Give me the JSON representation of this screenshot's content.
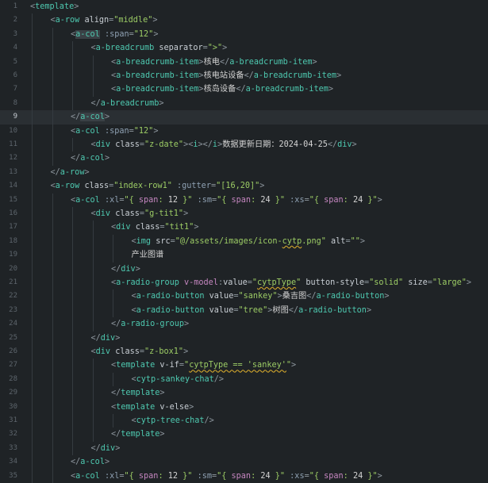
{
  "editor": {
    "current_line": 9,
    "lines": [
      {
        "n": "1",
        "i": 0,
        "t": [
          [
            "p",
            "<"
          ],
          [
            "tag",
            "template"
          ],
          [
            "p",
            ">"
          ]
        ]
      },
      {
        "n": "2",
        "i": 1,
        "t": [
          [
            "p",
            "<"
          ],
          [
            "tag",
            "a-row"
          ],
          [
            "p",
            " "
          ],
          [
            "attr",
            "align"
          ],
          [
            "p",
            "="
          ],
          [
            "str",
            "\"middle\""
          ],
          [
            "p",
            ">"
          ]
        ]
      },
      {
        "n": "3",
        "i": 2,
        "t": [
          [
            "p",
            "<"
          ],
          [
            "taghl",
            "a-col"
          ],
          [
            "p",
            " "
          ],
          [
            "bind",
            ":span"
          ],
          [
            "p",
            "="
          ],
          [
            "str",
            "\"12\""
          ],
          [
            "p",
            ">"
          ]
        ]
      },
      {
        "n": "4",
        "i": 3,
        "t": [
          [
            "p",
            "<"
          ],
          [
            "tag",
            "a-breadcrumb"
          ],
          [
            "p",
            " "
          ],
          [
            "attr",
            "separator"
          ],
          [
            "p",
            "="
          ],
          [
            "str",
            "\">\""
          ],
          [
            "p",
            ">"
          ]
        ]
      },
      {
        "n": "5",
        "i": 4,
        "t": [
          [
            "p",
            "<"
          ],
          [
            "tag",
            "a-breadcrumb-item"
          ],
          [
            "p",
            ">"
          ],
          [
            "text",
            "核电"
          ],
          [
            "p",
            "</"
          ],
          [
            "tag",
            "a-breadcrumb-item"
          ],
          [
            "p",
            ">"
          ]
        ]
      },
      {
        "n": "6",
        "i": 4,
        "t": [
          [
            "p",
            "<"
          ],
          [
            "tag",
            "a-breadcrumb-item"
          ],
          [
            "p",
            ">"
          ],
          [
            "text",
            "核电站设备"
          ],
          [
            "p",
            "</"
          ],
          [
            "tag",
            "a-breadcrumb-item"
          ],
          [
            "p",
            ">"
          ]
        ]
      },
      {
        "n": "7",
        "i": 4,
        "t": [
          [
            "p",
            "<"
          ],
          [
            "tag",
            "a-breadcrumb-item"
          ],
          [
            "p",
            ">"
          ],
          [
            "text",
            "核岛设备"
          ],
          [
            "p",
            "</"
          ],
          [
            "tag",
            "a-breadcrumb-item"
          ],
          [
            "p",
            ">"
          ]
        ]
      },
      {
        "n": "8",
        "i": 3,
        "t": [
          [
            "p",
            "</"
          ],
          [
            "tag",
            "a-breadcrumb"
          ],
          [
            "p",
            ">"
          ]
        ]
      },
      {
        "n": "9",
        "i": 2,
        "t": [
          [
            "p",
            "</"
          ],
          [
            "taghl",
            "a-col"
          ],
          [
            "p",
            ">"
          ]
        ]
      },
      {
        "n": "10",
        "i": 2,
        "t": [
          [
            "p",
            "<"
          ],
          [
            "tag",
            "a-col"
          ],
          [
            "p",
            " "
          ],
          [
            "bind",
            ":span"
          ],
          [
            "p",
            "="
          ],
          [
            "str",
            "\"12\""
          ],
          [
            "p",
            ">"
          ]
        ]
      },
      {
        "n": "11",
        "i": 3,
        "t": [
          [
            "p",
            "<"
          ],
          [
            "tag",
            "div"
          ],
          [
            "p",
            " "
          ],
          [
            "attr",
            "class"
          ],
          [
            "p",
            "="
          ],
          [
            "str",
            "\"z-date\""
          ],
          [
            "p",
            ">"
          ],
          [
            "p",
            "<"
          ],
          [
            "tag",
            "i"
          ],
          [
            "p",
            ">"
          ],
          [
            "p",
            "</"
          ],
          [
            "tag",
            "i"
          ],
          [
            "p",
            ">"
          ],
          [
            "text",
            "数据更新日期：2024-04-25"
          ],
          [
            "p",
            "</"
          ],
          [
            "tag",
            "div"
          ],
          [
            "p",
            ">"
          ]
        ]
      },
      {
        "n": "12",
        "i": 2,
        "t": [
          [
            "p",
            "</"
          ],
          [
            "tag",
            "a-col"
          ],
          [
            "p",
            ">"
          ]
        ]
      },
      {
        "n": "13",
        "i": 1,
        "t": [
          [
            "p",
            "</"
          ],
          [
            "tag",
            "a-row"
          ],
          [
            "p",
            ">"
          ]
        ]
      },
      {
        "n": "14",
        "i": 1,
        "t": [
          [
            "p",
            "<"
          ],
          [
            "tag",
            "a-row"
          ],
          [
            "p",
            " "
          ],
          [
            "attr",
            "class"
          ],
          [
            "p",
            "="
          ],
          [
            "str",
            "\"index-row1\""
          ],
          [
            "p",
            " "
          ],
          [
            "bind",
            ":gutter"
          ],
          [
            "p",
            "="
          ],
          [
            "str",
            "\"[16,20]\""
          ],
          [
            "p",
            ">"
          ]
        ]
      },
      {
        "n": "15",
        "i": 2,
        "t": [
          [
            "p",
            "<"
          ],
          [
            "tag",
            "a-col"
          ],
          [
            "p",
            " "
          ],
          [
            "bind",
            ":xl"
          ],
          [
            "p",
            "="
          ],
          [
            "str",
            "\"{ "
          ],
          [
            "kw",
            "span"
          ],
          [
            "str",
            ": "
          ],
          [
            "num",
            "12"
          ],
          [
            "str",
            " }\""
          ],
          [
            "p",
            " "
          ],
          [
            "bind",
            ":sm"
          ],
          [
            "p",
            "="
          ],
          [
            "str",
            "\"{ "
          ],
          [
            "kw",
            "span"
          ],
          [
            "str",
            ": "
          ],
          [
            "num",
            "24"
          ],
          [
            "str",
            " }\""
          ],
          [
            "p",
            " "
          ],
          [
            "bind",
            ":xs"
          ],
          [
            "p",
            "="
          ],
          [
            "str",
            "\"{ "
          ],
          [
            "kw",
            "span"
          ],
          [
            "str",
            ": "
          ],
          [
            "num",
            "24"
          ],
          [
            "str",
            " }\""
          ],
          [
            "p",
            ">"
          ]
        ]
      },
      {
        "n": "16",
        "i": 3,
        "t": [
          [
            "p",
            "<"
          ],
          [
            "tag",
            "div"
          ],
          [
            "p",
            " "
          ],
          [
            "attr",
            "class"
          ],
          [
            "p",
            "="
          ],
          [
            "str",
            "\"g-tit1\""
          ],
          [
            "p",
            ">"
          ]
        ]
      },
      {
        "n": "17",
        "i": 4,
        "t": [
          [
            "p",
            "<"
          ],
          [
            "tag",
            "div"
          ],
          [
            "p",
            " "
          ],
          [
            "attr",
            "class"
          ],
          [
            "p",
            "="
          ],
          [
            "str",
            "\"tit1\""
          ],
          [
            "p",
            ">"
          ]
        ]
      },
      {
        "n": "18",
        "i": 5,
        "t": [
          [
            "p",
            "<"
          ],
          [
            "tag",
            "img"
          ],
          [
            "p",
            " "
          ],
          [
            "attr",
            "src"
          ],
          [
            "p",
            "="
          ],
          [
            "str",
            "\"@/assets/images/icon-"
          ],
          [
            "strerr",
            "cytp"
          ],
          [
            "str",
            ".png\""
          ],
          [
            "p",
            " "
          ],
          [
            "attr",
            "alt"
          ],
          [
            "p",
            "="
          ],
          [
            "str",
            "\"\""
          ],
          [
            "p",
            ">"
          ]
        ]
      },
      {
        "n": "19",
        "i": 5,
        "t": [
          [
            "text",
            "产业图谱"
          ]
        ]
      },
      {
        "n": "20",
        "i": 4,
        "t": [
          [
            "p",
            "</"
          ],
          [
            "tag",
            "div"
          ],
          [
            "p",
            ">"
          ]
        ]
      },
      {
        "n": "21",
        "i": 4,
        "t": [
          [
            "p",
            "<"
          ],
          [
            "tag",
            "a-radio-group"
          ],
          [
            "p",
            " "
          ],
          [
            "kw",
            "v-model"
          ],
          [
            "p",
            ":"
          ],
          [
            "attr",
            "value"
          ],
          [
            "p",
            "="
          ],
          [
            "str",
            "\""
          ],
          [
            "strerr",
            "cytpType"
          ],
          [
            "str",
            "\""
          ],
          [
            "p",
            " "
          ],
          [
            "attr",
            "button-style"
          ],
          [
            "p",
            "="
          ],
          [
            "str",
            "\"solid\""
          ],
          [
            "p",
            " "
          ],
          [
            "attr",
            "size"
          ],
          [
            "p",
            "="
          ],
          [
            "str",
            "\"large\""
          ],
          [
            "p",
            ">"
          ]
        ]
      },
      {
        "n": "22",
        "i": 5,
        "t": [
          [
            "p",
            "<"
          ],
          [
            "tag",
            "a-radio-button"
          ],
          [
            "p",
            " "
          ],
          [
            "attr",
            "value"
          ],
          [
            "p",
            "="
          ],
          [
            "str",
            "\"sankey\""
          ],
          [
            "p",
            ">"
          ],
          [
            "text",
            "桑吉图"
          ],
          [
            "p",
            "</"
          ],
          [
            "tag",
            "a-radio-button"
          ],
          [
            "p",
            ">"
          ]
        ]
      },
      {
        "n": "23",
        "i": 5,
        "t": [
          [
            "p",
            "<"
          ],
          [
            "tag",
            "a-radio-button"
          ],
          [
            "p",
            " "
          ],
          [
            "attr",
            "value"
          ],
          [
            "p",
            "="
          ],
          [
            "str",
            "\"tree\""
          ],
          [
            "p",
            ">"
          ],
          [
            "text",
            "树图"
          ],
          [
            "p",
            "</"
          ],
          [
            "tag",
            "a-radio-button"
          ],
          [
            "p",
            ">"
          ]
        ]
      },
      {
        "n": "24",
        "i": 4,
        "t": [
          [
            "p",
            "</"
          ],
          [
            "tag",
            "a-radio-group"
          ],
          [
            "p",
            ">"
          ]
        ]
      },
      {
        "n": "25",
        "i": 3,
        "t": [
          [
            "p",
            "</"
          ],
          [
            "tag",
            "div"
          ],
          [
            "p",
            ">"
          ]
        ]
      },
      {
        "n": "26",
        "i": 3,
        "t": [
          [
            "p",
            "<"
          ],
          [
            "tag",
            "div"
          ],
          [
            "p",
            " "
          ],
          [
            "attr",
            "class"
          ],
          [
            "p",
            "="
          ],
          [
            "str",
            "\"z-box1\""
          ],
          [
            "p",
            ">"
          ]
        ]
      },
      {
        "n": "27",
        "i": 4,
        "t": [
          [
            "p",
            "<"
          ],
          [
            "tag",
            "template"
          ],
          [
            "p",
            " "
          ],
          [
            "attr",
            "v-if"
          ],
          [
            "p",
            "="
          ],
          [
            "str",
            "\""
          ],
          [
            "strerr",
            "cytpType == 'sankey'"
          ],
          [
            "str",
            "\""
          ],
          [
            "p",
            ">"
          ]
        ]
      },
      {
        "n": "28",
        "i": 5,
        "t": [
          [
            "p",
            "<"
          ],
          [
            "tag",
            "cytp-sankey-chat"
          ],
          [
            "p",
            "/>"
          ]
        ]
      },
      {
        "n": "29",
        "i": 4,
        "t": [
          [
            "p",
            "</"
          ],
          [
            "tag",
            "template"
          ],
          [
            "p",
            ">"
          ]
        ]
      },
      {
        "n": "30",
        "i": 4,
        "t": [
          [
            "p",
            "<"
          ],
          [
            "tag",
            "template"
          ],
          [
            "p",
            " "
          ],
          [
            "attr",
            "v-else"
          ],
          [
            "p",
            ">"
          ]
        ]
      },
      {
        "n": "31",
        "i": 5,
        "t": [
          [
            "p",
            "<"
          ],
          [
            "tag",
            "cytp-tree-chat"
          ],
          [
            "p",
            "/>"
          ]
        ]
      },
      {
        "n": "32",
        "i": 4,
        "t": [
          [
            "p",
            "</"
          ],
          [
            "tag",
            "template"
          ],
          [
            "p",
            ">"
          ]
        ]
      },
      {
        "n": "33",
        "i": 3,
        "t": [
          [
            "p",
            "</"
          ],
          [
            "tag",
            "div"
          ],
          [
            "p",
            ">"
          ]
        ]
      },
      {
        "n": "34",
        "i": 2,
        "t": [
          [
            "p",
            "</"
          ],
          [
            "tag",
            "a-col"
          ],
          [
            "p",
            ">"
          ]
        ]
      },
      {
        "n": "35",
        "i": 2,
        "t": [
          [
            "p",
            "<"
          ],
          [
            "tag",
            "a-col"
          ],
          [
            "p",
            " "
          ],
          [
            "bind",
            ":xl"
          ],
          [
            "p",
            "="
          ],
          [
            "str",
            "\"{ "
          ],
          [
            "kw",
            "span"
          ],
          [
            "str",
            ": "
          ],
          [
            "num",
            "12"
          ],
          [
            "str",
            " }\""
          ],
          [
            "p",
            " "
          ],
          [
            "bind",
            ":sm"
          ],
          [
            "p",
            "="
          ],
          [
            "str",
            "\"{ "
          ],
          [
            "kw",
            "span"
          ],
          [
            "str",
            ": "
          ],
          [
            "num",
            "24"
          ],
          [
            "str",
            " }\""
          ],
          [
            "p",
            " "
          ],
          [
            "bind",
            ":xs"
          ],
          [
            "p",
            "="
          ],
          [
            "str",
            "\"{ "
          ],
          [
            "kw",
            "span"
          ],
          [
            "str",
            ": "
          ],
          [
            "num",
            "24"
          ],
          [
            "str",
            " }\""
          ],
          [
            "p",
            ">"
          ]
        ]
      }
    ]
  }
}
